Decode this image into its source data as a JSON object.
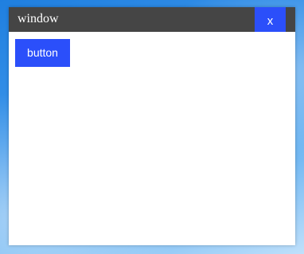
{
  "window": {
    "title": "window",
    "close_label": "x"
  },
  "content": {
    "button_label": "button"
  },
  "colors": {
    "titlebar": "#454545",
    "accent_button": "#2b4ffa",
    "window_background": "#ffffff",
    "desktop_background": "#3b95ea"
  }
}
